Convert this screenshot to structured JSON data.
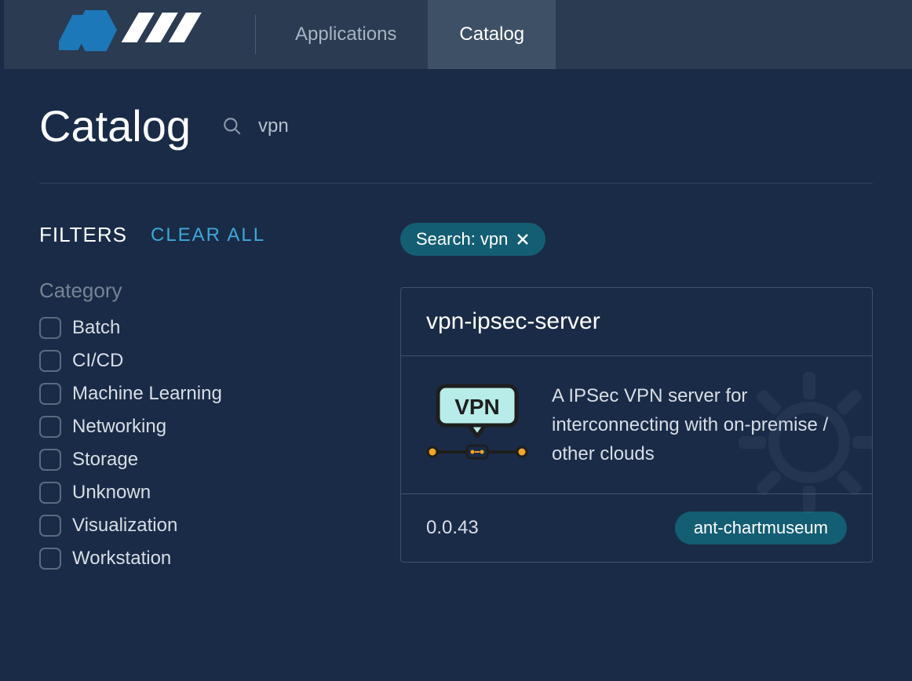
{
  "nav": {
    "tabs": [
      {
        "label": "Applications",
        "active": false
      },
      {
        "label": "Catalog",
        "active": true
      }
    ]
  },
  "page": {
    "title": "Catalog"
  },
  "search": {
    "value": "vpn"
  },
  "filters": {
    "title": "FILTERS",
    "clear_label": "CLEAR ALL",
    "category_label": "Category",
    "categories": [
      "Batch",
      "CI/CD",
      "Machine Learning",
      "Networking",
      "Storage",
      "Unknown",
      "Visualization",
      "Workstation"
    ]
  },
  "chip": {
    "label": "Search: vpn"
  },
  "result": {
    "title": "vpn-ipsec-server",
    "description": "A IPSec VPN server for interconnecting with on-premise / other clouds",
    "version": "0.0.43",
    "repo": "ant-chartmuseum"
  }
}
